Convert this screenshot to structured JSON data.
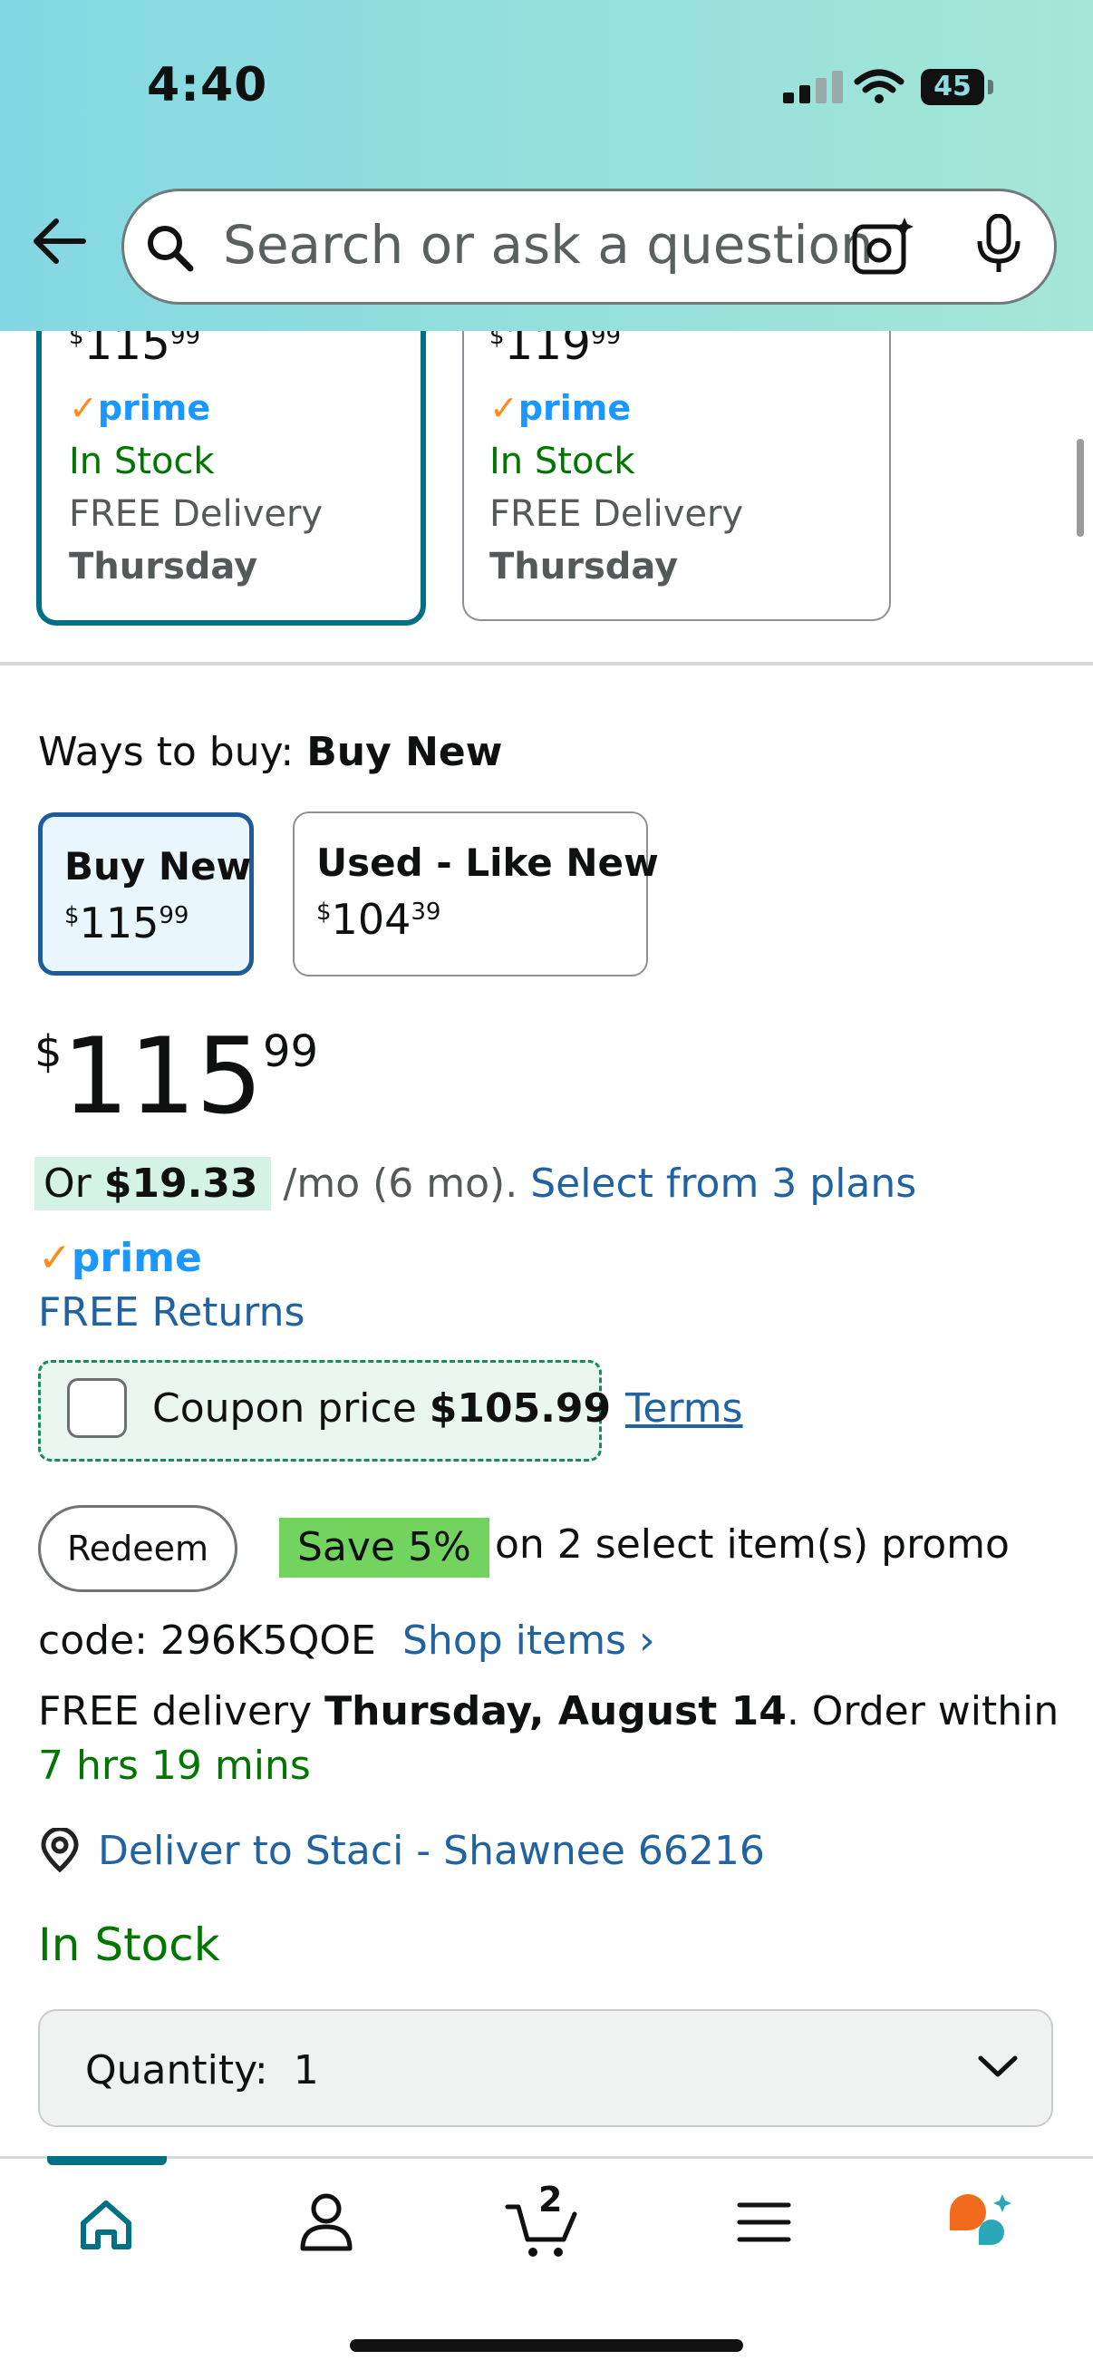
{
  "status_bar": {
    "time": "4:40",
    "battery": "45"
  },
  "search": {
    "placeholder": "Search or ask a question"
  },
  "compare_cards": [
    {
      "price_whole": "115",
      "price_cents": "99",
      "currency": "$",
      "prime": "prime",
      "stock": "In Stock",
      "delivery": "FREE Delivery",
      "day": "Thursday",
      "selected": true
    },
    {
      "price_whole": "119",
      "price_cents": "99",
      "currency": "$",
      "prime": "prime",
      "stock": "In Stock",
      "delivery": "FREE Delivery",
      "day": "Thursday",
      "selected": false
    }
  ],
  "ways_to_buy": {
    "label": "Ways to buy:",
    "selected": "Buy New",
    "options": [
      {
        "label": "Buy New",
        "currency": "$",
        "whole": "115",
        "cents": "99"
      },
      {
        "label": "Used - Like New",
        "currency": "$",
        "whole": "104",
        "cents": "39"
      }
    ]
  },
  "price": {
    "currency": "$",
    "whole": "115",
    "cents": "99"
  },
  "installments": {
    "prefix": "Or ",
    "amount": "$19.33",
    "suffix": "/mo (6 mo).",
    "link": "Select from 3 plans"
  },
  "prime_badge": "prime",
  "free_returns": "FREE Returns",
  "coupon": {
    "text": "Coupon price ",
    "price": "$105.99",
    "terms": "Terms"
  },
  "promo": {
    "redeem": "Redeem",
    "badge": "Save 5%",
    "text": "on 2 select item(s) promo",
    "code": "code: 296K5QOE",
    "shop": "Shop items ›"
  },
  "delivery": {
    "prefix": "FREE delivery ",
    "date": "Thursday, August 14",
    "middle": ". Order within ",
    "countdown": "7 hrs 19 mins"
  },
  "deliver_to": "Deliver to Staci - Shawnee 66216",
  "in_stock": "In Stock",
  "quantity": {
    "label": "Quantity:",
    "value": "1"
  },
  "bottom_nav": {
    "cart_count": "2",
    "items": [
      "home-icon",
      "account-icon",
      "cart-icon",
      "menu-icon",
      "rufus-icon"
    ]
  },
  "colors": {
    "teal": "#007185",
    "link": "#2162a1",
    "green": "#007600",
    "prime_blue": "#1a98ff",
    "prime_orange": "#ff8c1a",
    "save_green": "#72d45f"
  }
}
